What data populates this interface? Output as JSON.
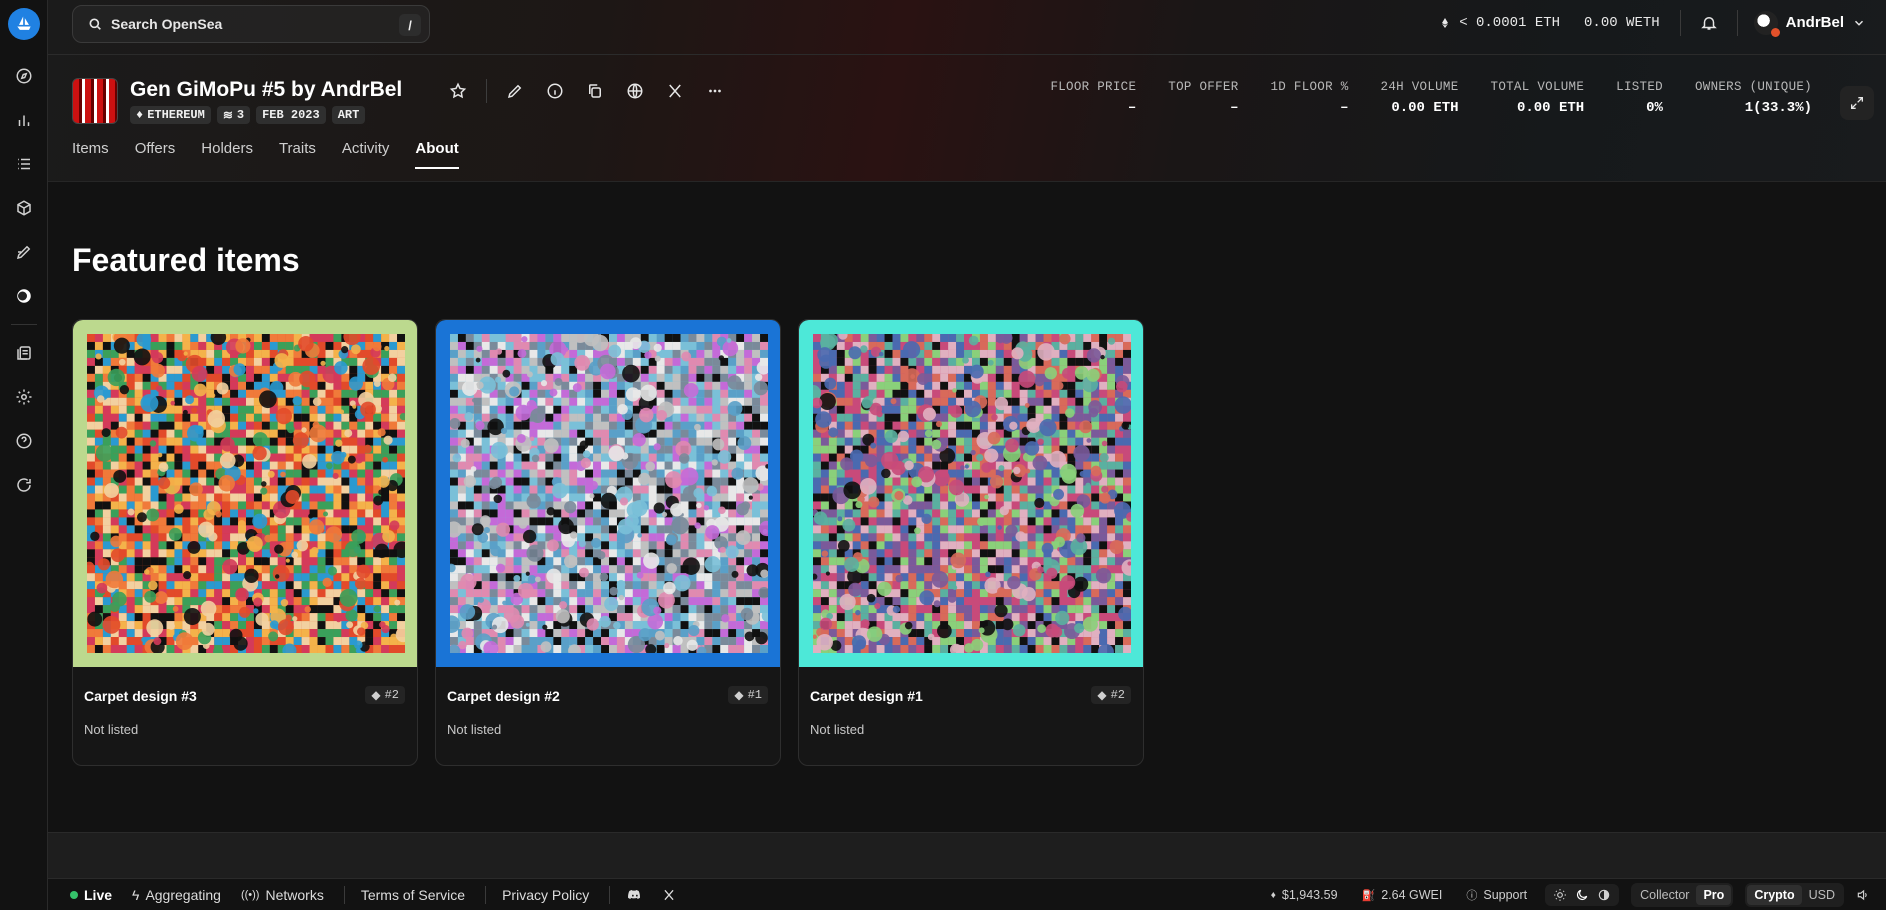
{
  "search": {
    "placeholder": "Search OpenSea",
    "shortcut": "/"
  },
  "wallet": {
    "eth": "< 0.0001 ETH",
    "weth": "0.00 WETH"
  },
  "user": {
    "name": "AndrBel"
  },
  "collection": {
    "title": "Gen GiMoPu #5 by AndrBel",
    "chips": {
      "chain": "ETHEREUM",
      "items": "3",
      "date": "FEB 2023",
      "category": "ART"
    }
  },
  "stats": [
    {
      "label": "FLOOR PRICE",
      "value": "–"
    },
    {
      "label": "TOP OFFER",
      "value": "–"
    },
    {
      "label": "1D FLOOR %",
      "value": "–"
    },
    {
      "label": "24H VOLUME",
      "value": "0.00 ETH"
    },
    {
      "label": "TOTAL VOLUME",
      "value": "0.00 ETH"
    },
    {
      "label": "LISTED",
      "value": "0%"
    },
    {
      "label": "OWNERS (UNIQUE)",
      "value": "1(33.3%)"
    }
  ],
  "tabs": [
    {
      "label": "Items"
    },
    {
      "label": "Offers"
    },
    {
      "label": "Holders"
    },
    {
      "label": "Traits"
    },
    {
      "label": "Activity"
    },
    {
      "label": "About",
      "active": true
    }
  ],
  "section": {
    "title": "Featured items"
  },
  "cards": [
    {
      "name": "Carpet design #3",
      "rank": "#2",
      "status": "Not listed",
      "frame": "#bcd98e",
      "palette": [
        "#e24a2a",
        "#f07a3a",
        "#d43a5a",
        "#f4b24a",
        "#3aa05a",
        "#2a9ad0",
        "#111111",
        "#f2d0a0"
      ]
    },
    {
      "name": "Carpet design #2",
      "rank": "#1",
      "status": "Not listed",
      "frame": "#1a74d6",
      "palette": [
        "#7ac0d8",
        "#c0c0c0",
        "#5aa0c8",
        "#c46ad8",
        "#e8e8e8",
        "#7a8a9a",
        "#111111",
        "#e08ab0"
      ]
    },
    {
      "name": "Carpet design #1",
      "rank": "#2",
      "status": "Not listed",
      "frame": "#4de8d8",
      "palette": [
        "#c84a7a",
        "#7a5a9a",
        "#5ab0a0",
        "#d86a5a",
        "#4a6ab0",
        "#e0b0c0",
        "#111111",
        "#8ad07a"
      ]
    }
  ],
  "footer": {
    "live": "Live",
    "aggregating": "Aggregating",
    "networks": "Networks",
    "terms": "Terms of Service",
    "privacy": "Privacy Policy",
    "eth_price": "$1,943.59",
    "gas": "2.64 GWEI",
    "support": "Support",
    "mode": [
      "Collector",
      "Pro"
    ],
    "currency": [
      "Crypto",
      "USD"
    ]
  },
  "colors": {
    "accent": "#2081e2",
    "live": "#35c26a",
    "background": "#121212"
  }
}
